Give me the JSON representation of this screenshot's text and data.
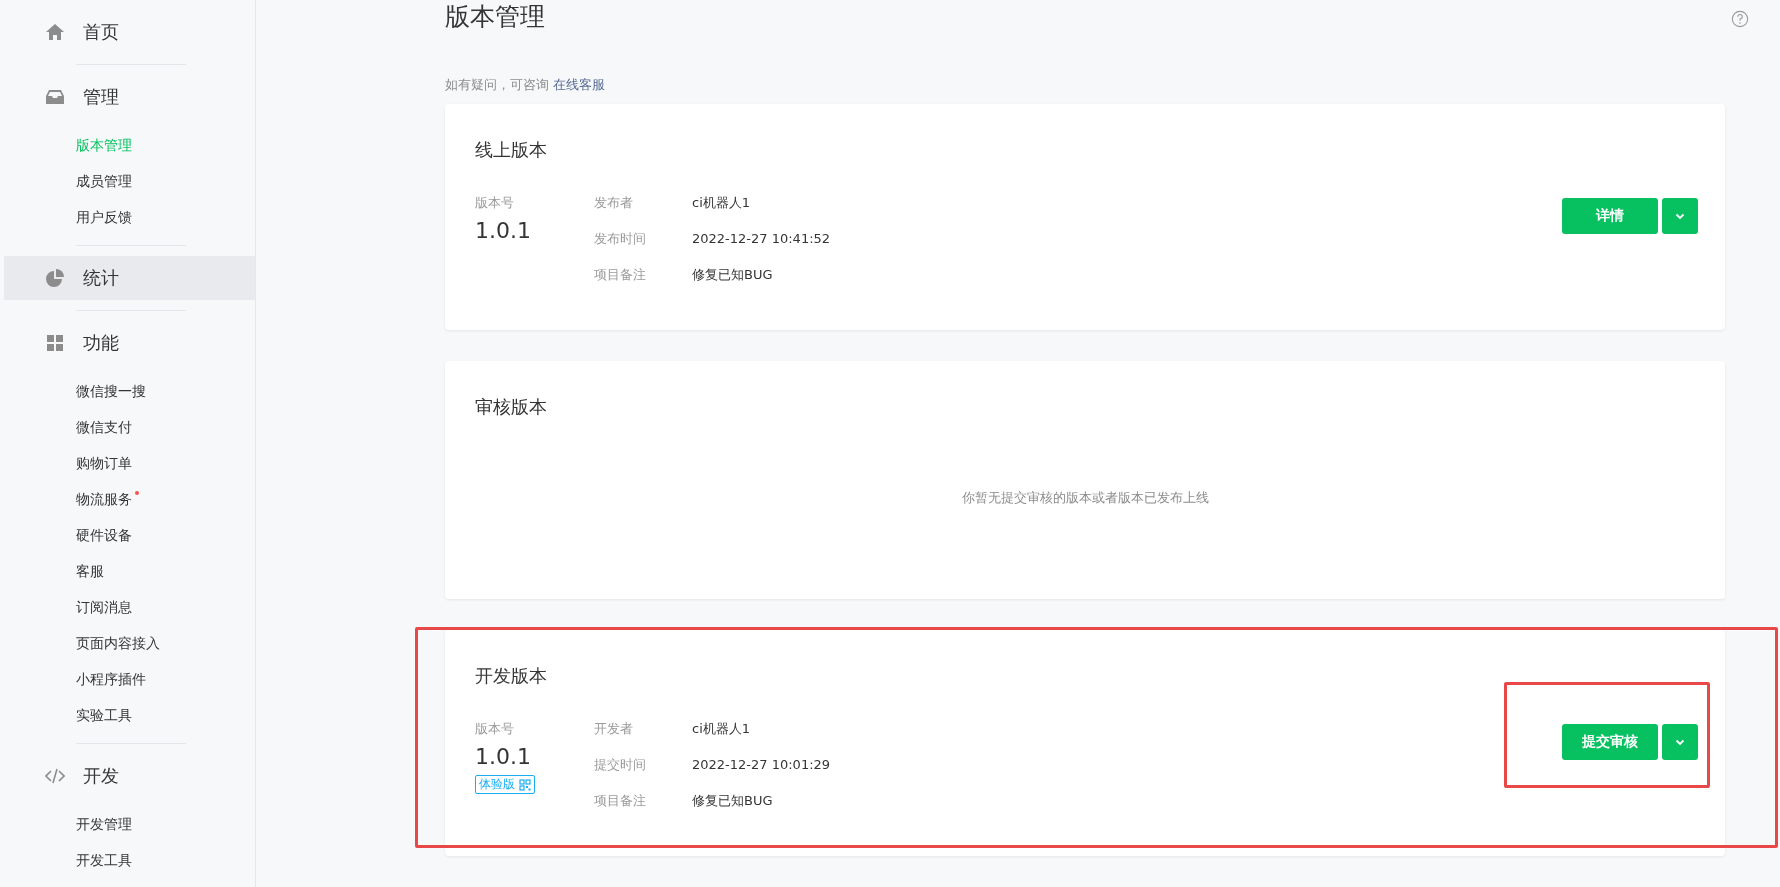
{
  "sidebar": {
    "sections": [
      {
        "kind": "home",
        "label": "首页",
        "selected": false
      },
      {
        "kind": "inbox",
        "label": "管理",
        "selected": false,
        "items": [
          {
            "label": "版本管理",
            "selected": true,
            "dot": false
          },
          {
            "label": "成员管理",
            "selected": false,
            "dot": false
          },
          {
            "label": "用户反馈",
            "selected": false,
            "dot": false
          }
        ]
      },
      {
        "kind": "pie",
        "label": "统计",
        "selected": true
      },
      {
        "kind": "grid",
        "label": "功能",
        "selected": false,
        "items": [
          {
            "label": "微信搜一搜",
            "selected": false,
            "dot": false
          },
          {
            "label": "微信支付",
            "selected": false,
            "dot": false
          },
          {
            "label": "购物订单",
            "selected": false,
            "dot": false
          },
          {
            "label": "物流服务",
            "selected": false,
            "dot": true
          },
          {
            "label": "硬件设备",
            "selected": false,
            "dot": false
          },
          {
            "label": "客服",
            "selected": false,
            "dot": false
          },
          {
            "label": "订阅消息",
            "selected": false,
            "dot": false
          },
          {
            "label": "页面内容接入",
            "selected": false,
            "dot": false
          },
          {
            "label": "小程序插件",
            "selected": false,
            "dot": false
          },
          {
            "label": "实验工具",
            "selected": false,
            "dot": false
          }
        ]
      },
      {
        "kind": "code",
        "label": "开发",
        "selected": false,
        "items": [
          {
            "label": "开发管理",
            "selected": false,
            "dot": false
          },
          {
            "label": "开发工具",
            "selected": false,
            "dot": false
          }
        ]
      }
    ]
  },
  "page": {
    "title": "版本管理",
    "hint": "如有疑问，可咨询",
    "hint_link": "在线客服"
  },
  "cards": [
    {
      "kind": "version",
      "title": "线上版本",
      "version_label": "版本号",
      "version": "1.0.1",
      "fields": [
        {
          "label": "发布者",
          "value": "ci机器人1"
        },
        {
          "label": "发布时间",
          "value": "2022-12-27 10:41:52"
        },
        {
          "label": "项目备注",
          "value": "修复已知BUG"
        }
      ],
      "button": "详情",
      "highlighted": false
    },
    {
      "kind": "empty",
      "title": "审核版本",
      "message": "你暂无提交审核的版本或者版本已发布上线",
      "highlighted": false
    },
    {
      "kind": "version",
      "title": "开发版本",
      "version_label": "版本号",
      "version": "1.0.1",
      "badge": "体验版",
      "fields": [
        {
          "label": "开发者",
          "value": "ci机器人1"
        },
        {
          "label": "提交时间",
          "value": "2022-12-27 10:01:29"
        },
        {
          "label": "项目备注",
          "value": "修复已知BUG"
        }
      ],
      "button": "提交审核",
      "highlighted": true
    }
  ]
}
